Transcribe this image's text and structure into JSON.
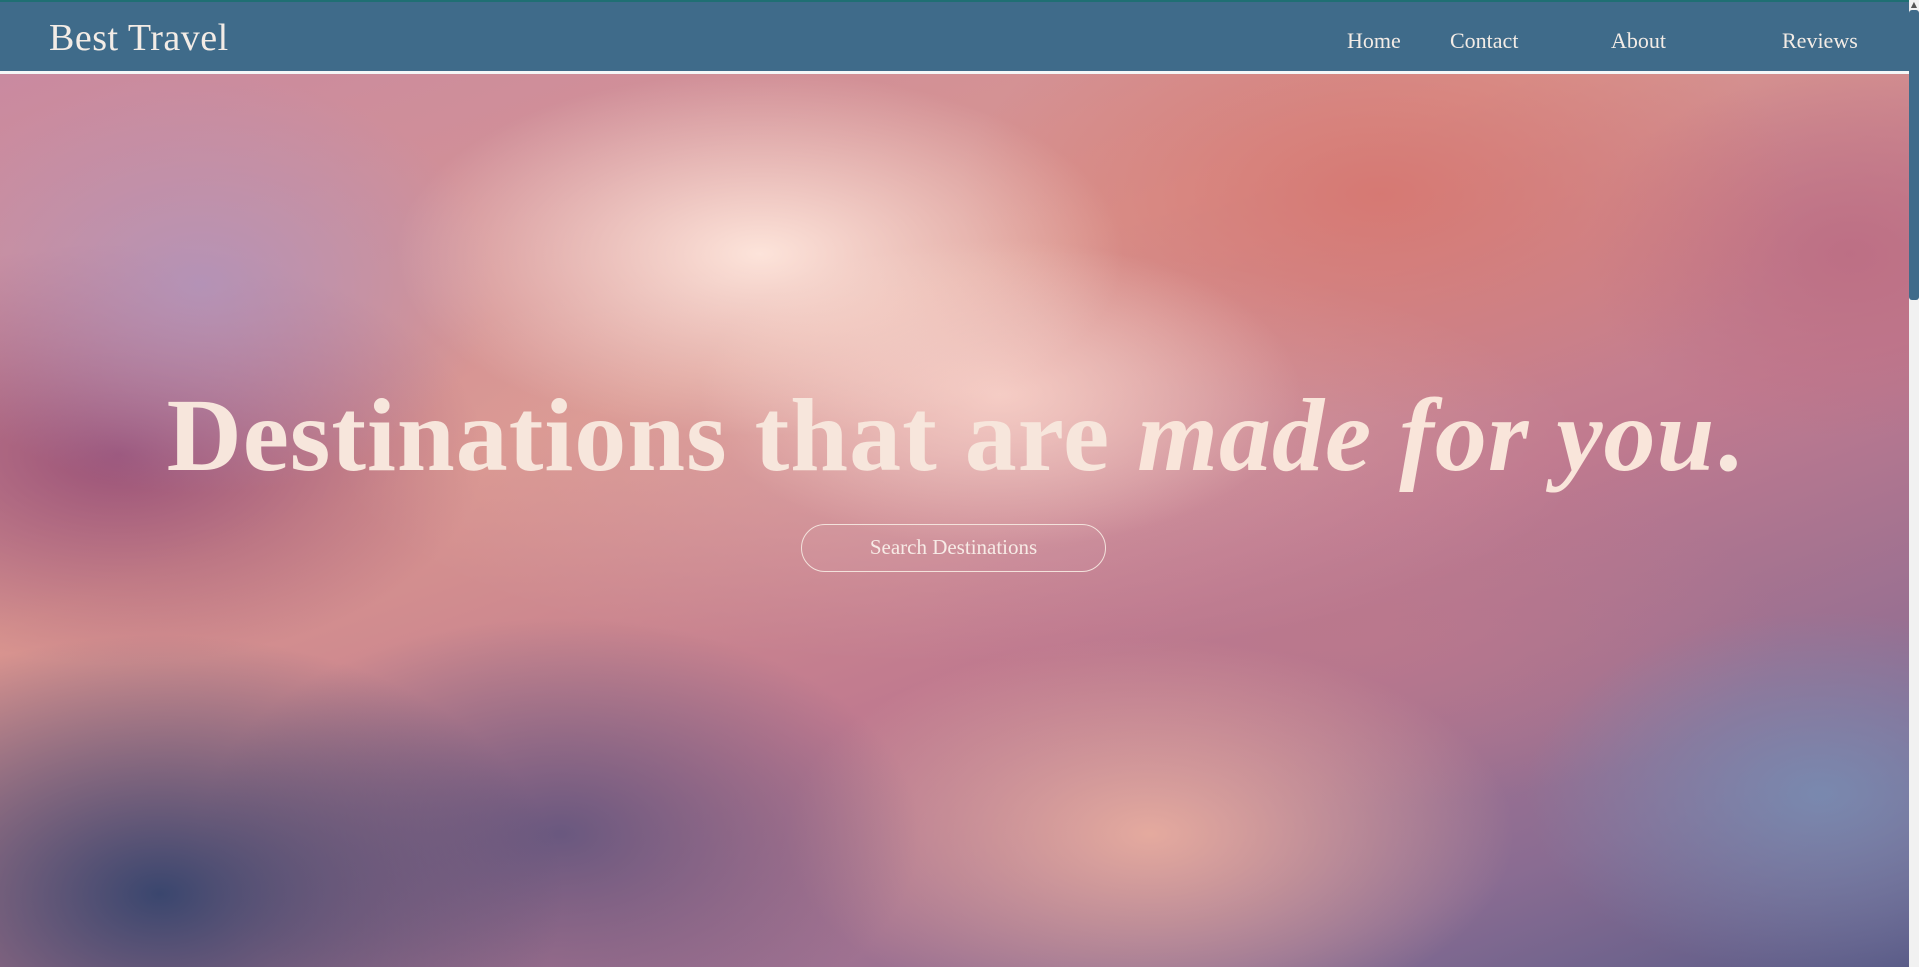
{
  "header": {
    "brand": "Best Travel",
    "nav": [
      "Home",
      "Contact",
      "About",
      "Reviews"
    ]
  },
  "hero": {
    "headline_plain": "Destinations that are ",
    "headline_emphasis": "made for you",
    "headline_period": ".",
    "search_button": "Search Destinations"
  },
  "scrollbar": {
    "arrow_icon": "caret-up-icon"
  },
  "colors": {
    "navbar": "#3f6b8a",
    "text_light": "#f3ece6"
  }
}
